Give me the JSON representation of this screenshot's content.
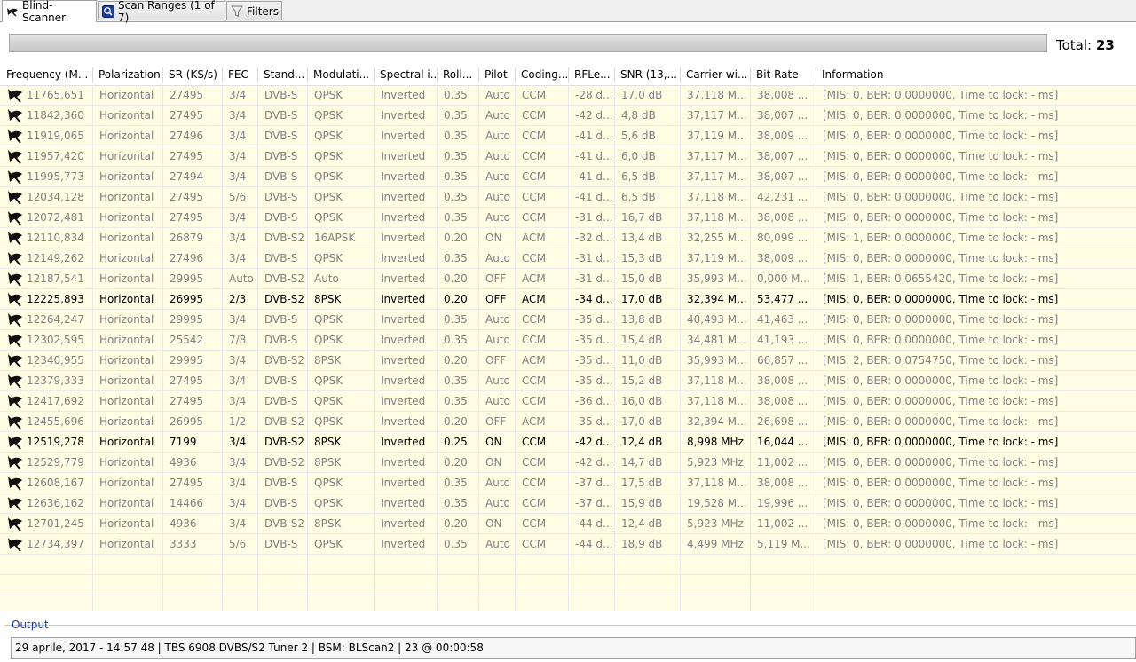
{
  "tabs": [
    {
      "label": "Blind-Scanner",
      "icon": "satellite-dish-icon",
      "active": true
    },
    {
      "label": "Scan Ranges (1 of 7)",
      "icon": "scan-ranges-icon",
      "active": false
    },
    {
      "label": "Filters",
      "icon": "filter-icon",
      "active": false
    }
  ],
  "progress": {
    "fraction": 0
  },
  "total": {
    "label": "Total:",
    "value": "23"
  },
  "columns": [
    "Frequency (M...",
    "Polarization",
    "SR (KS/s)",
    "FEC",
    "Stand...",
    "Modulati...",
    "Spectral i...",
    "Roll...",
    "Pilot",
    "Coding...",
    "RFLe...",
    "SNR (13,...",
    "Carrier wi...",
    "Bit Rate",
    "Information"
  ],
  "rows": [
    {
      "bold": false,
      "cells": [
        "11765,651",
        "Horizontal",
        "27495",
        "3/4",
        "DVB-S",
        "QPSK",
        "Inverted",
        "0.35",
        "Auto",
        "CCM",
        "-28 d...",
        "17,0 dB",
        "37,118 M...",
        "38,008 ...",
        "[MIS: 0, BER: 0,0000000, Time to lock: - ms]"
      ]
    },
    {
      "bold": false,
      "cells": [
        "11842,360",
        "Horizontal",
        "27495",
        "3/4",
        "DVB-S",
        "QPSK",
        "Inverted",
        "0.35",
        "Auto",
        "CCM",
        "-42 d...",
        "4,8 dB",
        "37,117 M...",
        "38,007 ...",
        "[MIS: 0, BER: 0,0000000, Time to lock: - ms]"
      ]
    },
    {
      "bold": false,
      "cells": [
        "11919,065",
        "Horizontal",
        "27496",
        "3/4",
        "DVB-S",
        "QPSK",
        "Inverted",
        "0.35",
        "Auto",
        "CCM",
        "-41 d...",
        "5,6 dB",
        "37,119 M...",
        "38,009 ...",
        "[MIS: 0, BER: 0,0000000, Time to lock: - ms]"
      ]
    },
    {
      "bold": false,
      "cells": [
        "11957,420",
        "Horizontal",
        "27495",
        "3/4",
        "DVB-S",
        "QPSK",
        "Inverted",
        "0.35",
        "Auto",
        "CCM",
        "-41 d...",
        "6,0 dB",
        "37,117 M...",
        "38,007 ...",
        "[MIS: 0, BER: 0,0000000, Time to lock: - ms]"
      ]
    },
    {
      "bold": false,
      "cells": [
        "11995,773",
        "Horizontal",
        "27494",
        "3/4",
        "DVB-S",
        "QPSK",
        "Inverted",
        "0.35",
        "Auto",
        "CCM",
        "-41 d...",
        "6,5 dB",
        "37,117 M...",
        "38,007 ...",
        "[MIS: 0, BER: 0,0000000, Time to lock: - ms]"
      ]
    },
    {
      "bold": false,
      "cells": [
        "12034,128",
        "Horizontal",
        "27495",
        "5/6",
        "DVB-S",
        "QPSK",
        "Inverted",
        "0.35",
        "Auto",
        "CCM",
        "-41 d...",
        "6,5 dB",
        "37,118 M...",
        "42,231 ...",
        "[MIS: 0, BER: 0,0000000, Time to lock: - ms]"
      ]
    },
    {
      "bold": false,
      "cells": [
        "12072,481",
        "Horizontal",
        "27495",
        "3/4",
        "DVB-S",
        "QPSK",
        "Inverted",
        "0.35",
        "Auto",
        "CCM",
        "-31 d...",
        "16,7 dB",
        "37,118 M...",
        "38,008 ...",
        "[MIS: 0, BER: 0,0000000, Time to lock: - ms]"
      ]
    },
    {
      "bold": false,
      "cells": [
        "12110,834",
        "Horizontal",
        "26879",
        "3/4",
        "DVB-S2",
        "16APSK",
        "Inverted",
        "0.20",
        "ON",
        "ACM",
        "-32 d...",
        "13,4 dB",
        "32,255 M...",
        "80,099 ...",
        "[MIS: 1, BER: 0,0000000, Time to lock: - ms]"
      ]
    },
    {
      "bold": false,
      "cells": [
        "12149,262",
        "Horizontal",
        "27496",
        "3/4",
        "DVB-S",
        "QPSK",
        "Inverted",
        "0.35",
        "Auto",
        "CCM",
        "-31 d...",
        "15,3 dB",
        "37,119 M...",
        "38,009 ...",
        "[MIS: 0, BER: 0,0000000, Time to lock: - ms]"
      ]
    },
    {
      "bold": false,
      "cells": [
        "12187,541",
        "Horizontal",
        "29995",
        "Auto",
        "DVB-S2",
        "Auto",
        "Inverted",
        "0.20",
        "OFF",
        "ACM",
        "-31 d...",
        "15,0 dB",
        "35,993 M...",
        "0,000 M...",
        "[MIS: 1, BER: 0,0655420, Time to lock: - ms]"
      ]
    },
    {
      "bold": true,
      "cells": [
        "12225,893",
        "Horizontal",
        "26995",
        "2/3",
        "DVB-S2",
        "8PSK",
        "Inverted",
        "0.20",
        "OFF",
        "ACM",
        "-34 d...",
        "17,0 dB",
        "32,394 M...",
        "53,477 ...",
        "[MIS: 0, BER: 0,0000000, Time to lock: - ms]"
      ]
    },
    {
      "bold": false,
      "cells": [
        "12264,247",
        "Horizontal",
        "29995",
        "3/4",
        "DVB-S",
        "QPSK",
        "Inverted",
        "0.35",
        "Auto",
        "CCM",
        "-35 d...",
        "13,8 dB",
        "40,493 M...",
        "41,463 ...",
        "[MIS: 0, BER: 0,0000000, Time to lock: - ms]"
      ]
    },
    {
      "bold": false,
      "cells": [
        "12302,595",
        "Horizontal",
        "25542",
        "7/8",
        "DVB-S",
        "QPSK",
        "Inverted",
        "0.35",
        "Auto",
        "CCM",
        "-35 d...",
        "15,4 dB",
        "34,481 M...",
        "41,193 ...",
        "[MIS: 0, BER: 0,0000000, Time to lock: - ms]"
      ]
    },
    {
      "bold": false,
      "cells": [
        "12340,955",
        "Horizontal",
        "29995",
        "3/4",
        "DVB-S2",
        "8PSK",
        "Inverted",
        "0.20",
        "OFF",
        "ACM",
        "-35 d...",
        "11,0 dB",
        "35,993 M...",
        "66,857 ...",
        "[MIS: 2, BER: 0,0754750, Time to lock: - ms]"
      ]
    },
    {
      "bold": false,
      "cells": [
        "12379,333",
        "Horizontal",
        "27495",
        "3/4",
        "DVB-S",
        "QPSK",
        "Inverted",
        "0.35",
        "Auto",
        "CCM",
        "-35 d...",
        "15,2 dB",
        "37,118 M...",
        "38,008 ...",
        "[MIS: 0, BER: 0,0000000, Time to lock: - ms]"
      ]
    },
    {
      "bold": false,
      "cells": [
        "12417,692",
        "Horizontal",
        "27495",
        "3/4",
        "DVB-S",
        "QPSK",
        "Inverted",
        "0.35",
        "Auto",
        "CCM",
        "-36 d...",
        "16,0 dB",
        "37,118 M...",
        "38,008 ...",
        "[MIS: 0, BER: 0,0000000, Time to lock: - ms]"
      ]
    },
    {
      "bold": false,
      "cells": [
        "12455,696",
        "Horizontal",
        "26995",
        "1/2",
        "DVB-S2",
        "QPSK",
        "Inverted",
        "0.20",
        "OFF",
        "ACM",
        "-35 d...",
        "17,0 dB",
        "32,394 M...",
        "26,698 ...",
        "[MIS: 0, BER: 0,0000000, Time to lock: - ms]"
      ]
    },
    {
      "bold": true,
      "cells": [
        "12519,278",
        "Horizontal",
        "7199",
        "3/4",
        "DVB-S2",
        "8PSK",
        "Inverted",
        "0.25",
        "ON",
        "CCM",
        "-42 d...",
        "12,4 dB",
        "8,998 MHz",
        "16,044 ...",
        "[MIS: 0, BER: 0,0000000, Time to lock: - ms]"
      ]
    },
    {
      "bold": false,
      "cells": [
        "12529,779",
        "Horizontal",
        "4936",
        "3/4",
        "DVB-S2",
        "8PSK",
        "Inverted",
        "0.20",
        "ON",
        "CCM",
        "-42 d...",
        "14,7 dB",
        "5,923 MHz",
        "11,002 ...",
        "[MIS: 0, BER: 0,0000000, Time to lock: - ms]"
      ]
    },
    {
      "bold": false,
      "cells": [
        "12608,167",
        "Horizontal",
        "27495",
        "3/4",
        "DVB-S",
        "QPSK",
        "Inverted",
        "0.35",
        "Auto",
        "CCM",
        "-37 d...",
        "17,5 dB",
        "37,118 M...",
        "38,008 ...",
        "[MIS: 0, BER: 0,0000000, Time to lock: - ms]"
      ]
    },
    {
      "bold": false,
      "cells": [
        "12636,162",
        "Horizontal",
        "14466",
        "3/4",
        "DVB-S",
        "QPSK",
        "Inverted",
        "0.35",
        "Auto",
        "CCM",
        "-37 d...",
        "15,9 dB",
        "19,528 M...",
        "19,996 ...",
        "[MIS: 0, BER: 0,0000000, Time to lock: - ms]"
      ]
    },
    {
      "bold": false,
      "cells": [
        "12701,245",
        "Horizontal",
        "4936",
        "3/4",
        "DVB-S2",
        "8PSK",
        "Inverted",
        "0.20",
        "ON",
        "CCM",
        "-44 d...",
        "12,4 dB",
        "5,923 MHz",
        "11,002 ...",
        "[MIS: 0, BER: 0,0000000, Time to lock: - ms]"
      ]
    },
    {
      "bold": false,
      "cells": [
        "12734,397",
        "Horizontal",
        "3333",
        "5/6",
        "DVB-S",
        "QPSK",
        "Inverted",
        "0.35",
        "Auto",
        "CCM",
        "-44 d...",
        "18,9 dB",
        "4,499 MHz",
        "5,119 M...",
        "[MIS: 0, BER: 0,0000000, Time to lock: - ms]"
      ]
    }
  ],
  "output": {
    "label": "Output",
    "text": "29 aprile, 2017 - 14:57 48 | TBS 6908 DVBS/S2 Tuner 2 | BSM: BLScan2 | 23 @ 00:00:58"
  },
  "colors": {
    "row_bg": "#fffde3",
    "dim_text": "#808080",
    "output_label": "#1a3aa0"
  }
}
